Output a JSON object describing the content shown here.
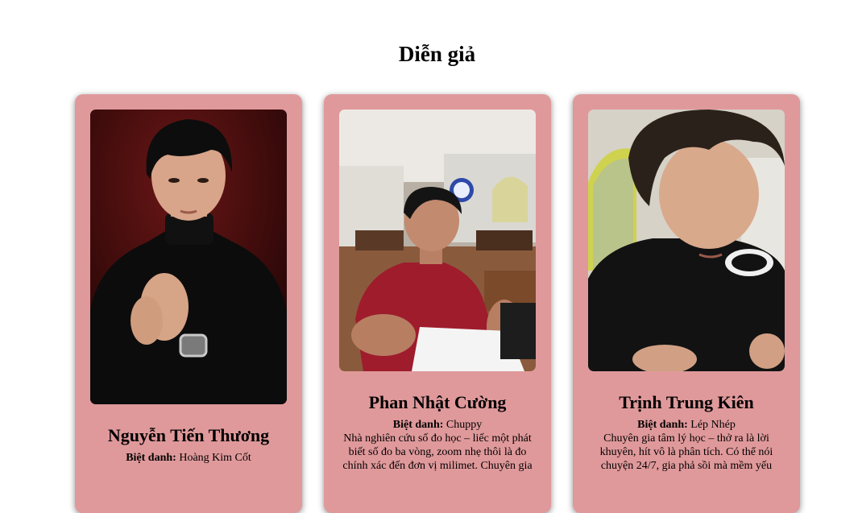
{
  "section": {
    "title": "Diễn giả"
  },
  "speakers": [
    {
      "name": "Nguyễn Tiến Thương",
      "alias_label": "Biệt danh:",
      "alias": "Hoàng Kim Cốt",
      "description": "",
      "photo": "portrait-black-turtleneck"
    },
    {
      "name": "Phan Nhật Cường",
      "alias_label": "Biệt danh:",
      "alias": "Chuppy",
      "description": "Nhà nghiên cứu số đo học – liếc một phát biết số đo ba vòng, zoom nhẹ thôi là đo chính xác đến đơn vị milimet. Chuyên gia",
      "photo": "cafe-red-shirt"
    },
    {
      "name": "Trịnh Trung Kiên",
      "alias_label": "Biệt danh:",
      "alias": "Lép Nhép",
      "description": "Chuyên gia tâm lý học – thở ra là lời khuyên, hít vô là phân tích. Có thể nói chuyện 24/7, gia phả sồi mà mềm yếu",
      "photo": "selfie-black-tshirt"
    }
  ],
  "colors": {
    "card_bg": "#e0999b",
    "page_bg": "#ffffff"
  }
}
